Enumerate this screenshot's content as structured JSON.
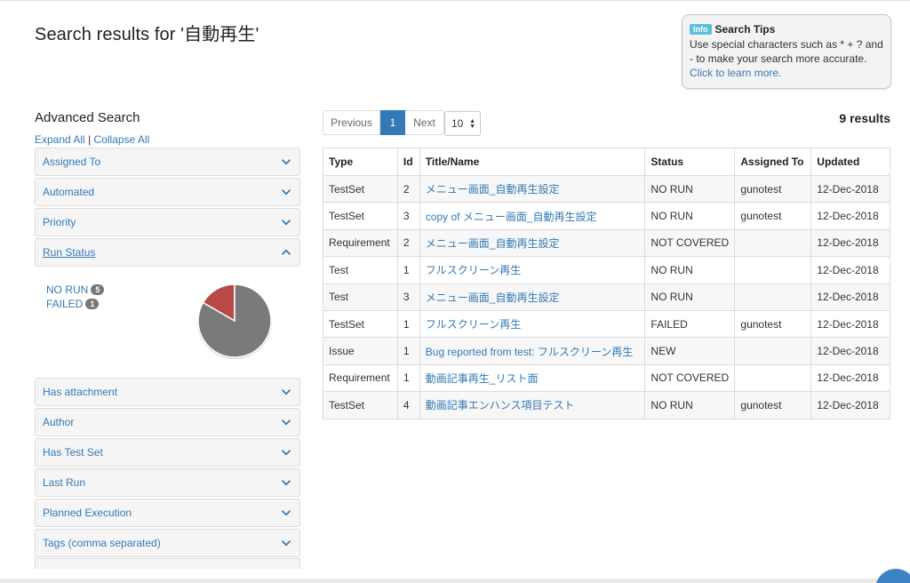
{
  "page": {
    "title": "Search results for '自動再生'"
  },
  "tips": {
    "badge": "Info",
    "heading": "Search Tips",
    "text": "Use special characters such as * + ? and - to make your search more accurate.",
    "link": "Click to learn more."
  },
  "advanced": {
    "title": "Advanced Search",
    "expand_all": "Expand All",
    "separator": "|",
    "collapse_all": "Collapse All",
    "filters_top": [
      {
        "label": "Assigned To",
        "state": "collapsed"
      },
      {
        "label": "Automated",
        "state": "collapsed"
      },
      {
        "label": "Priority",
        "state": "collapsed"
      },
      {
        "label": "Run Status",
        "state": "expanded"
      }
    ],
    "filters_bottom": [
      {
        "label": "Has attachment",
        "state": "collapsed"
      },
      {
        "label": "Author",
        "state": "collapsed"
      },
      {
        "label": "Has Test Set",
        "state": "collapsed"
      },
      {
        "label": "Last Run",
        "state": "collapsed"
      },
      {
        "label": "Planned Execution",
        "state": "collapsed"
      },
      {
        "label": "Tags (comma separated)",
        "state": "collapsed"
      }
    ],
    "run_status": {
      "items": [
        {
          "label": "NO RUN",
          "count": "5",
          "value": 5,
          "color": "#7a7a7a"
        },
        {
          "label": "FAILED",
          "count": "1",
          "value": 1,
          "color": "#b54a47"
        }
      ]
    }
  },
  "pager": {
    "prev": "Previous",
    "current": "1",
    "next": "Next",
    "page_size": "10"
  },
  "results": {
    "count_text": "9 results",
    "columns": [
      "Type",
      "Id",
      "Title/Name",
      "Status",
      "Assigned To",
      "Updated"
    ],
    "rows": [
      {
        "type": "TestSet",
        "id": "2",
        "title": "メニュー画面_自動再生設定",
        "status": "NO RUN",
        "assigned": "gunotest",
        "updated": "12-Dec-2018"
      },
      {
        "type": "TestSet",
        "id": "3",
        "title": "copy of メニュー画面_自動再生設定",
        "status": "NO RUN",
        "assigned": "gunotest",
        "updated": "12-Dec-2018"
      },
      {
        "type": "Requirement",
        "id": "2",
        "title": "メニュー画面_自動再生設定",
        "status": "NOT COVERED",
        "assigned": "",
        "updated": "12-Dec-2018"
      },
      {
        "type": "Test",
        "id": "1",
        "title": "フルスクリーン再生",
        "status": "NO RUN",
        "assigned": "",
        "updated": "12-Dec-2018"
      },
      {
        "type": "Test",
        "id": "3",
        "title": "メニュー画面_自動再生設定",
        "status": "NO RUN",
        "assigned": "",
        "updated": "12-Dec-2018"
      },
      {
        "type": "TestSet",
        "id": "1",
        "title": "フルスクリーン再生",
        "status": "FAILED",
        "assigned": "gunotest",
        "updated": "12-Dec-2018"
      },
      {
        "type": "Issue",
        "id": "1",
        "title": "Bug reported from test: フルスクリーン再生",
        "status": "NEW",
        "assigned": "",
        "updated": "12-Dec-2018"
      },
      {
        "type": "Requirement",
        "id": "1",
        "title": "動画記事再生_リスト面",
        "status": "NOT COVERED",
        "assigned": "",
        "updated": "12-Dec-2018"
      },
      {
        "type": "TestSet",
        "id": "4",
        "title": "動画記事エンハンス項目テスト",
        "status": "NO RUN",
        "assigned": "gunotest",
        "updated": "12-Dec-2018"
      }
    ]
  },
  "colors": {
    "link": "#337ab7",
    "accent": "#337ab7",
    "info_badge": "#5bc0de"
  }
}
